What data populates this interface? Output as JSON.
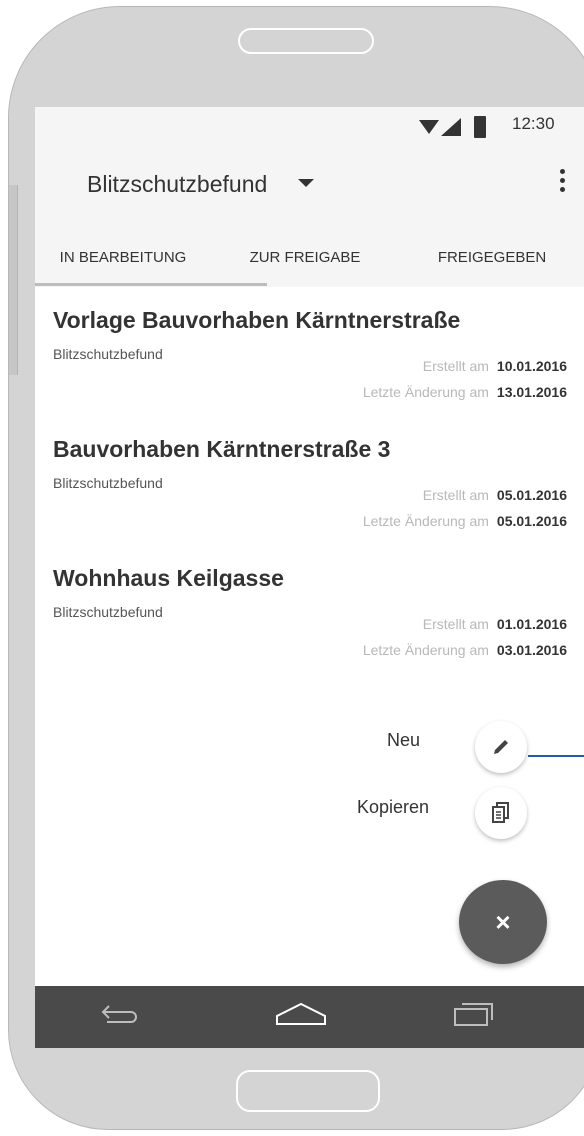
{
  "status_bar": {
    "time": "12:30"
  },
  "app_bar": {
    "title": "Blitzschutzbefund"
  },
  "tabs": [
    {
      "label": "IN BEARBEITUNG"
    },
    {
      "label": "ZUR FREIGABE"
    },
    {
      "label": "FREIGEGEBEN"
    }
  ],
  "items": [
    {
      "name": "Vorlage Bauvorhaben Kärntnerstraße",
      "type": "Blitzschutzbefund",
      "created_label": "Erstellt am",
      "created": "10.01.2016",
      "modified_label": "Letzte Änderung am",
      "modified": "13.01.2016"
    },
    {
      "name": "Bauvorhaben Kärntnerstraße 3",
      "type": "Blitzschutzbefund",
      "created_label": "Erstellt am",
      "created": "05.01.2016",
      "modified_label": "Letzte Änderung am",
      "modified": "05.01.2016"
    },
    {
      "name": "Wohnhaus Keilgasse",
      "type": "Blitzschutzbefund",
      "created_label": "Erstellt am",
      "created": "01.01.2016",
      "modified_label": "Letzte Änderung am",
      "modified": "03.01.2016"
    }
  ],
  "fab_menu": {
    "new_label": "Neu",
    "copy_label": "Kopieren",
    "close_symbol": "×"
  },
  "icons": {
    "wifi": "wifi-icon",
    "signal": "signal-icon",
    "battery": "battery-icon",
    "dropdown": "caret-down-icon",
    "overflow": "more-vert-icon",
    "edit": "pencil-icon",
    "copy": "copy-icon",
    "close": "close-icon",
    "back": "back-icon",
    "home": "home-icon",
    "recents": "recents-icon"
  },
  "colors": {
    "fab": "#5b5b5b",
    "nav_bar": "#4a4a4a",
    "pointer_line": "#1f5fa8"
  }
}
